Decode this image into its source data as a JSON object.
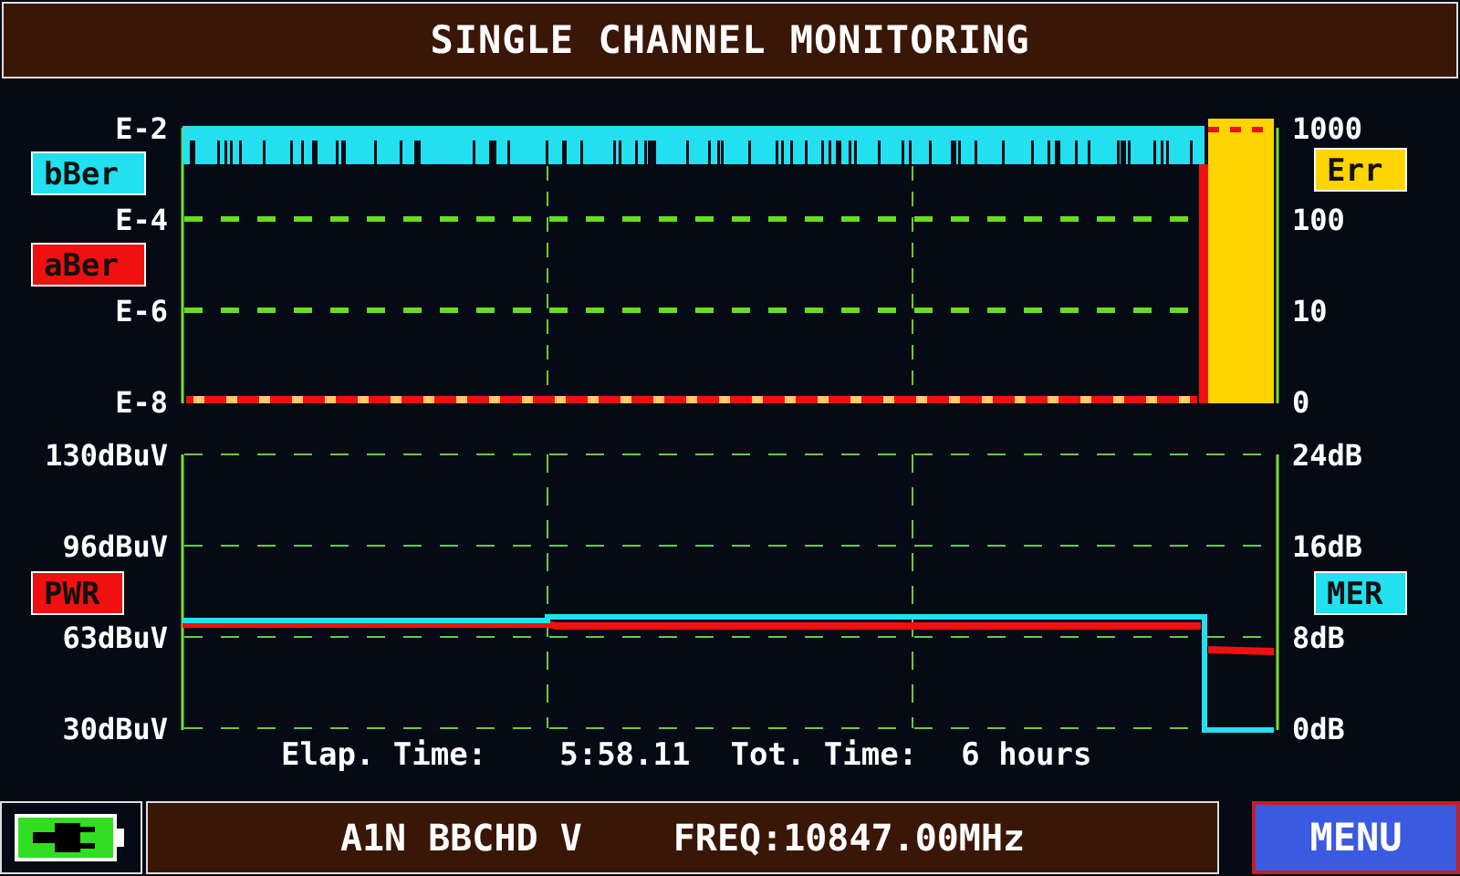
{
  "title": "SINGLE CHANNEL MONITORING",
  "charts": [
    {
      "kind": "ber",
      "left_ticks": [
        "E-2",
        "E-4",
        "E-6",
        "E-8"
      ],
      "right_ticks": [
        "1000",
        "100",
        "10",
        "0"
      ],
      "legends": [
        {
          "label": "bBer",
          "color": "#22e0f0"
        },
        {
          "label": "aBer",
          "color": "#f01010"
        },
        {
          "label": "Err",
          "color": "#ffd400"
        }
      ]
    },
    {
      "kind": "level",
      "left_ticks": [
        "130dBuV",
        "96dBuV",
        "63dBuV",
        "30dBuV"
      ],
      "right_ticks": [
        "24dB",
        "16dB",
        "8dB",
        "0dB"
      ],
      "legends": [
        {
          "label": "PWR",
          "color": "#f01010"
        },
        {
          "label": "MER",
          "color": "#22e0f0"
        }
      ]
    }
  ],
  "time": {
    "elapsed_label": "Elap. Time:",
    "elapsed_value": "5:58.11",
    "total_label": "Tot. Time:",
    "total_value": "6 hours"
  },
  "status_bar": {
    "channel": "A1N BBCHD V",
    "frequency": "FREQ:10847.00MHz"
  },
  "menu_button": "MENU"
}
